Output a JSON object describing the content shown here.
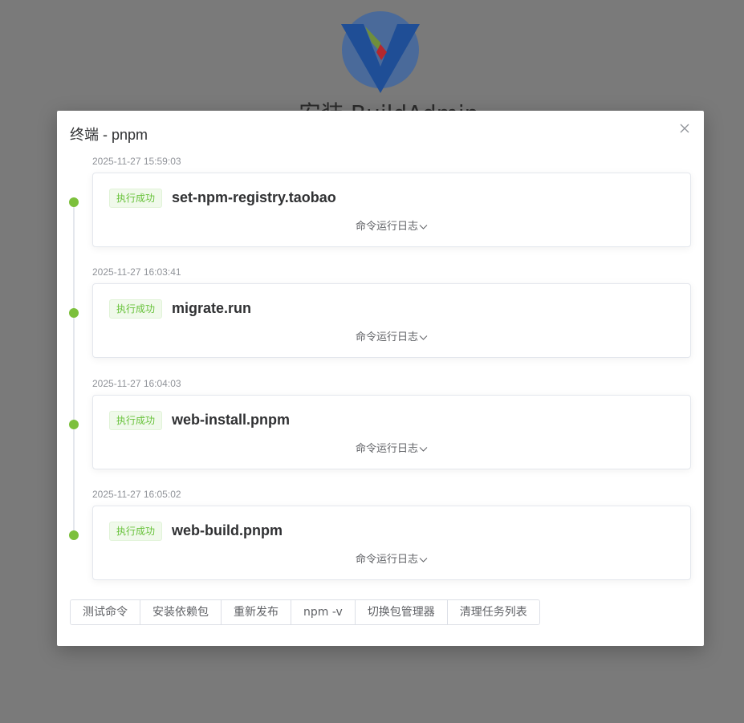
{
  "background": {
    "title": "安装 BuildAdmin",
    "logo_icon": "buildadmin-v-logo-icon"
  },
  "dialog": {
    "title": "终端 - pnpm",
    "close_icon": "close-icon"
  },
  "colors": {
    "success_green": "#67c23a",
    "dot_green": "#7cc03c",
    "overlay": "#7a7a7a"
  },
  "tasks": [
    {
      "timestamp": "2025-11-27 15:59:03",
      "status": "执行成功",
      "command": "set-npm-registry.taobao",
      "log_toggle": "命令运行日志"
    },
    {
      "timestamp": "2025-11-27 16:03:41",
      "status": "执行成功",
      "command": "migrate.run",
      "log_toggle": "命令运行日志"
    },
    {
      "timestamp": "2025-11-27 16:04:03",
      "status": "执行成功",
      "command": "web-install.pnpm",
      "log_toggle": "命令运行日志"
    },
    {
      "timestamp": "2025-11-27 16:05:02",
      "status": "执行成功",
      "command": "web-build.pnpm",
      "log_toggle": "命令运行日志"
    }
  ],
  "buttons": [
    "测试命令",
    "安装依赖包",
    "重新发布",
    "npm -v",
    "切换包管理器",
    "清理任务列表"
  ]
}
